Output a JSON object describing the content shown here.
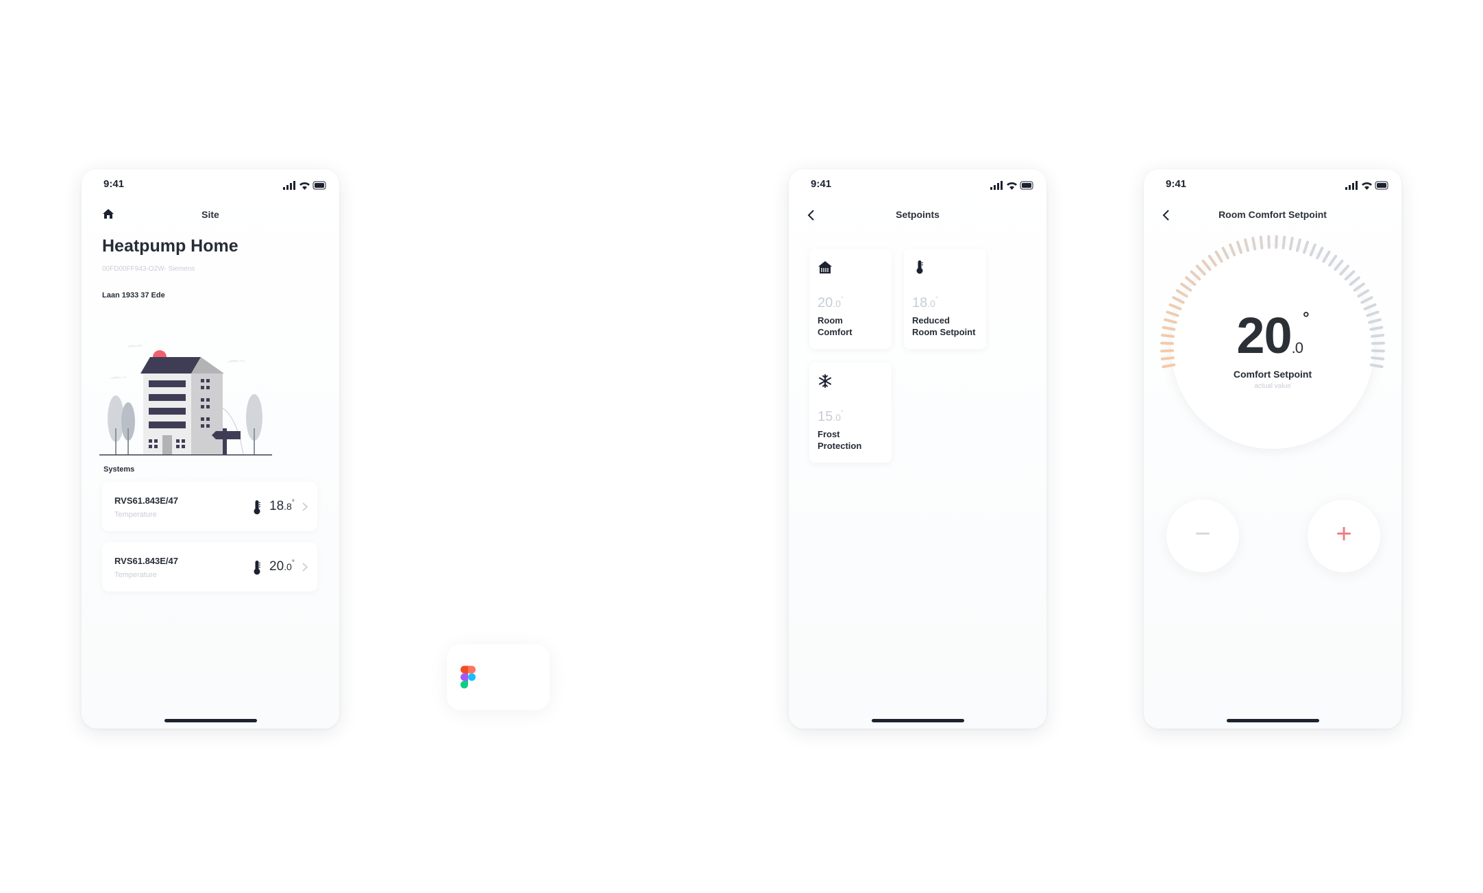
{
  "status": {
    "time": "9:41"
  },
  "site_screen": {
    "nav_title": "Site",
    "site_name": "Heatpump Home",
    "site_id": "00FD00FF943-O2W- Siemens",
    "address": "Laan 1933 37 Ede",
    "systems_label": "Systems",
    "systems": [
      {
        "name": "RVS61.843E/47",
        "subtitle": "Temperature",
        "value_int": "18",
        "value_dec": ".8",
        "degree": "°"
      },
      {
        "name": "RVS61.843E/47",
        "subtitle": "Temperature",
        "value_int": "20",
        "value_dec": ".0",
        "degree": "°"
      }
    ]
  },
  "setpoints_screen": {
    "nav_title": "Setpoints",
    "cards": [
      {
        "icon": "house-icon",
        "value_int": "20",
        "value_dec": ".0",
        "degree": "°",
        "label_line1": "Room",
        "label_line2": "Comfort"
      },
      {
        "icon": "thermometer-icon",
        "value_int": "18",
        "value_dec": ".0",
        "degree": "°",
        "label_line1": "Reduced",
        "label_line2": "Room Setpoint"
      },
      {
        "icon": "snowflake-icon",
        "value_int": "15",
        "value_dec": ".0",
        "degree": "°",
        "label_line1": "Frost",
        "label_line2": "Protection"
      }
    ]
  },
  "comfort_screen": {
    "nav_title": "Room Comfort Setpoint",
    "value_int": "20",
    "value_dec": ".0",
    "degree": "°",
    "label": "Comfort Setpoint",
    "sublabel": "actual value",
    "minus": "−",
    "plus": "+",
    "colors": {
      "accent": "#f07a86",
      "dial_warm": "#f6c9a4",
      "dial_cool": "#d3d7de"
    }
  }
}
